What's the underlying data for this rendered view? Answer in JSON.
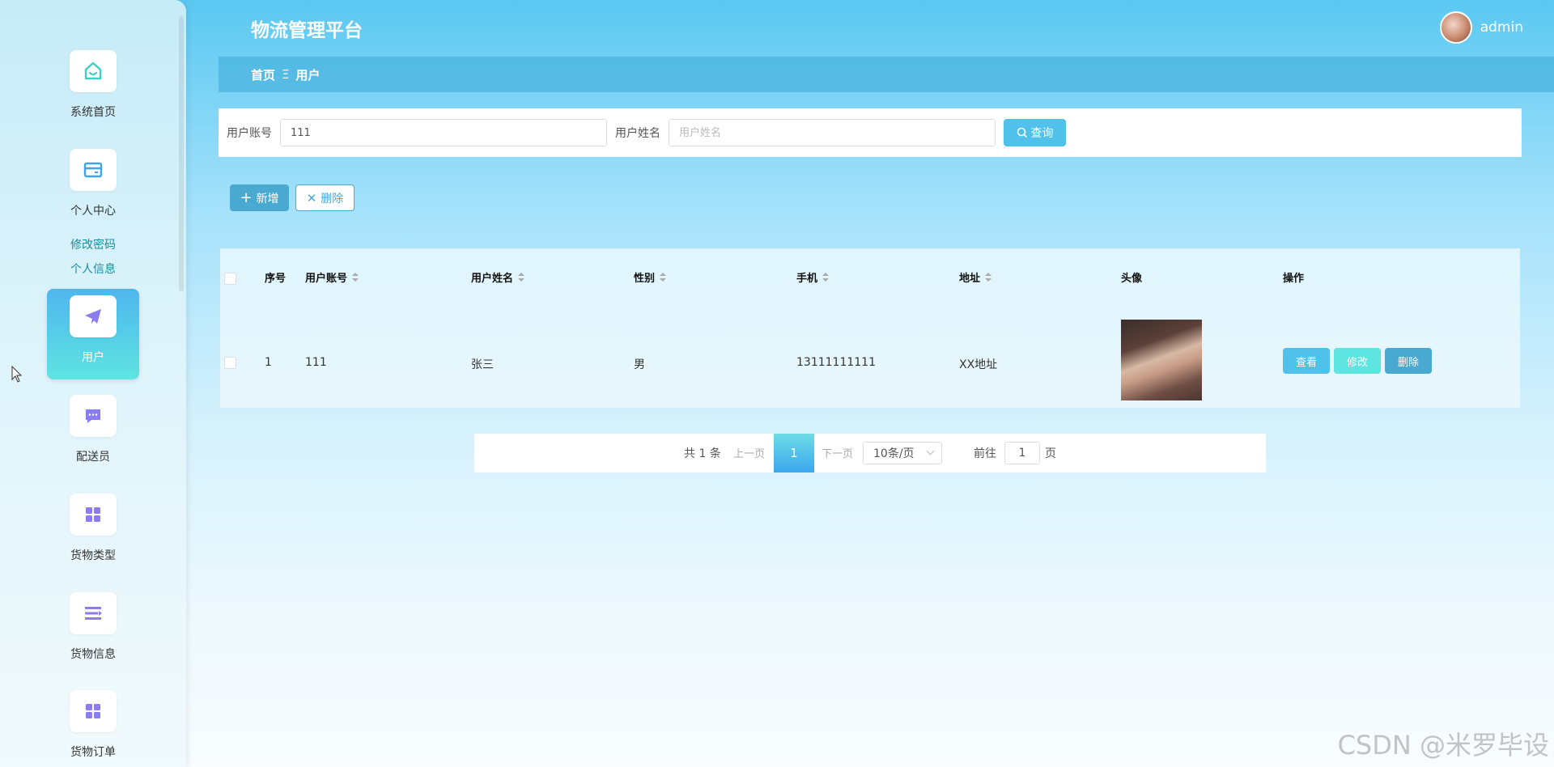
{
  "header": {
    "app_title": "物流管理平台",
    "username": "admin",
    "avatar_icon": "user-avatar"
  },
  "sidebar": {
    "items": [
      {
        "label": "系统首页",
        "icon": "home-icon"
      },
      {
        "label": "个人中心",
        "icon": "card-icon"
      },
      {
        "label": "用户",
        "icon": "paper-plane-icon"
      },
      {
        "label": "配送员",
        "icon": "chat-icon"
      },
      {
        "label": "货物类型",
        "icon": "grid-icon"
      },
      {
        "label": "货物信息",
        "icon": "list-icon"
      },
      {
        "label": "货物订单",
        "icon": "grid-icon"
      }
    ],
    "submenu": [
      "修改密码",
      "个人信息"
    ]
  },
  "breadcrumb": {
    "home": "首页",
    "separator": "Ξ",
    "current": "用户"
  },
  "search": {
    "account_label": "用户账号",
    "account_value": "111",
    "name_label": "用户姓名",
    "name_placeholder": "用户姓名",
    "query_button": "查询"
  },
  "actions": {
    "add": "新增",
    "delete": "删除"
  },
  "table": {
    "columns": [
      "序号",
      "用户账号",
      "用户姓名",
      "性别",
      "手机",
      "地址",
      "头像",
      "操作"
    ],
    "rows": [
      {
        "index": "1",
        "account": "111",
        "name": "张三",
        "gender": "男",
        "phone": "13111111111",
        "address": "XX地址",
        "view": "查看",
        "edit": "修改",
        "delete": "删除"
      }
    ]
  },
  "pagination": {
    "total": "共 1 条",
    "prev": "上一页",
    "current_page": "1",
    "next": "下一页",
    "page_size": "10条/页",
    "goto_label": "前往",
    "goto_value": "1",
    "page_suffix": "页"
  },
  "colors": {
    "primary": "#4fc1ea",
    "add_button": "#4aa9d1",
    "view_button": "#4fc1ea",
    "edit_button": "#5ee4e1",
    "delete_button": "#4aa9d1",
    "icon_purple": "#8b7cf0",
    "icon_teal": "#3ecfc4"
  },
  "watermark": "CSDN @米罗毕设"
}
